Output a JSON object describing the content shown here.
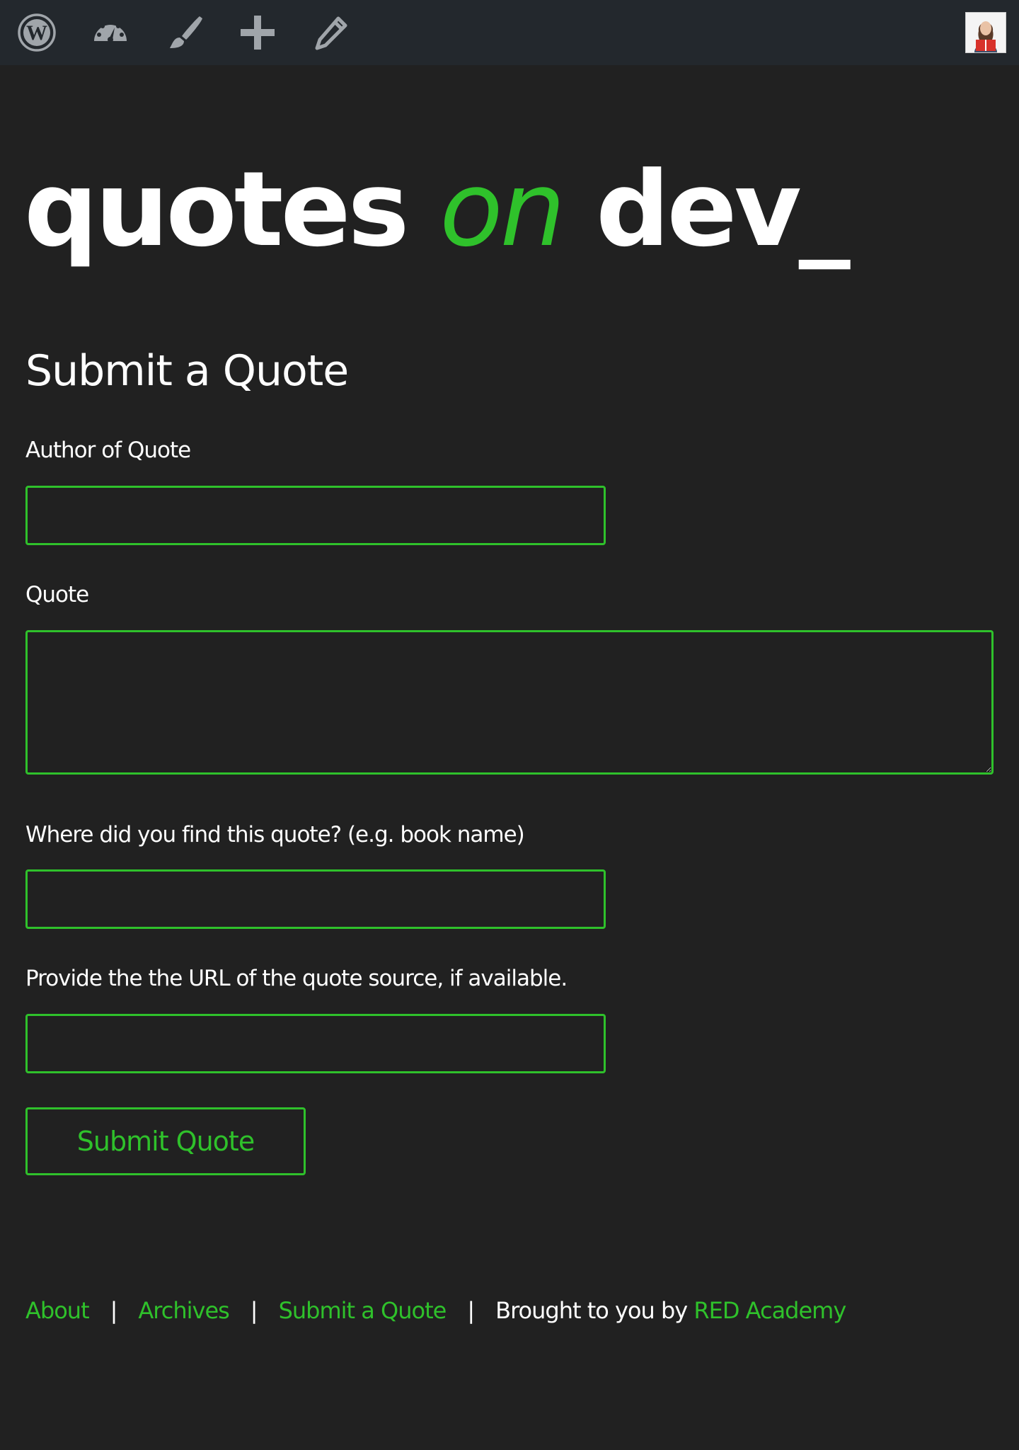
{
  "admin_bar": {
    "icons": [
      "wordpress-icon",
      "dashboard-icon",
      "customize-brush-icon",
      "new-content-plus-icon",
      "edit-pencil-icon"
    ],
    "avatar": "user-avatar"
  },
  "site": {
    "title_part1": "quotes",
    "title_part2": "on",
    "title_part3": "dev_"
  },
  "page": {
    "title": "Submit a Quote"
  },
  "form": {
    "author_label": "Author of Quote",
    "author_value": "",
    "quote_label": "Quote",
    "quote_value": "",
    "source_label": "Where did you find this quote? (e.g. book name)",
    "source_value": "",
    "url_label": "Provide the the URL of the quote source, if available.",
    "url_value": "",
    "submit_label": "Submit Quote"
  },
  "footer": {
    "about": "About",
    "sep1": "|",
    "archives": "Archives",
    "sep2": "|",
    "submit": "Submit a Quote",
    "sep3": "|",
    "credit_prefix": "Brought to you by",
    "credit_link": "RED Academy"
  },
  "colors": {
    "accent": "#2fc12b",
    "background": "#212121",
    "admin_bar": "#23282d",
    "admin_icon": "#a0a5aa"
  }
}
